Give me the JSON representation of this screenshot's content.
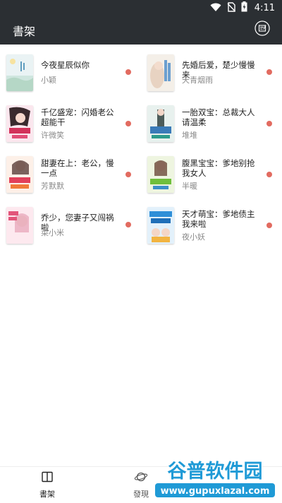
{
  "status_bar": {
    "time": "4:11",
    "icons": [
      "wifi-icon",
      "no-sim-icon",
      "battery-charging-icon"
    ]
  },
  "app_bar": {
    "title": "書架",
    "action_icon": "notes-icon"
  },
  "colors": {
    "app_bar_bg": "#2b2f33",
    "unread_dot": "#e26b60",
    "author_text": "#8a8a8a"
  },
  "books": [
    {
      "title": "今夜星辰似你",
      "author": "小颖",
      "unread": true
    },
    {
      "title": "先婚后爱，楚少慢慢来",
      "author": "天青烟雨",
      "unread": true
    },
    {
      "title": "千亿盛宠：闪婚老公超能干",
      "author": "许微笑",
      "unread": true
    },
    {
      "title": "一胎双宝：总裁大人请温柔",
      "author": "堆堆",
      "unread": true
    },
    {
      "title": "甜妻在上：老公，慢一点",
      "author": "芳默默",
      "unread": true
    },
    {
      "title": "腹黑宝宝：爹地别抢我女人",
      "author": "半暖",
      "unread": true
    },
    {
      "title": "乔少，您妻子又闯祸啦",
      "author": "菜小米",
      "unread": true
    },
    {
      "title": "天才萌宝：爹地债主我来啦",
      "author": "夜小妖",
      "unread": true
    }
  ],
  "bottom_nav": {
    "items": [
      {
        "label": "書架",
        "icon": "book-icon",
        "active": true
      },
      {
        "label": "發現",
        "icon": "planet-icon",
        "active": false
      }
    ]
  },
  "watermark": {
    "text": "谷普软件园",
    "url": "www.gupuxlazal.com"
  }
}
